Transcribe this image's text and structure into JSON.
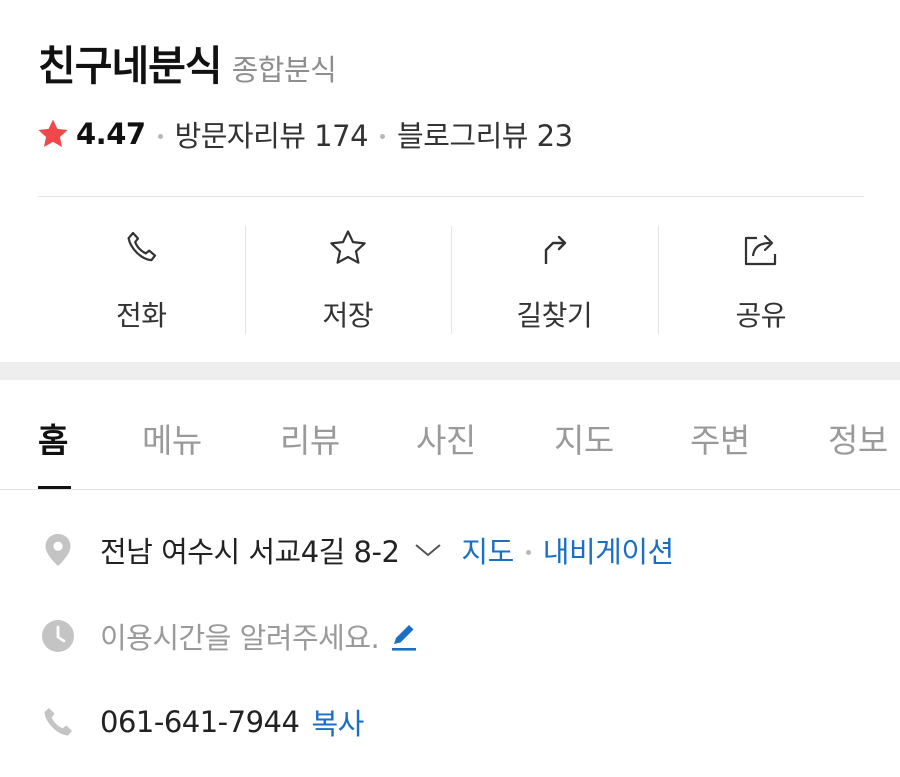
{
  "place": {
    "name": "친구네분식",
    "category": "종합분식",
    "rating": "4.47",
    "visitor_reviews": "방문자리뷰 174",
    "blog_reviews": "블로그리뷰 23"
  },
  "actions": {
    "call": "전화",
    "save": "저장",
    "directions": "길찾기",
    "share": "공유"
  },
  "tabs": {
    "home": "홈",
    "menu": "메뉴",
    "reviews": "리뷰",
    "photos": "사진",
    "map": "지도",
    "nearby": "주변",
    "info": "정보"
  },
  "details": {
    "address": "전남 여수시 서교4길 8-2",
    "map_link": "지도",
    "navigation_link": "내비게이션",
    "hours_prompt": "이용시간을 알려주세요.",
    "phone": "061-641-7944",
    "copy_link": "복사"
  },
  "colors": {
    "star": "#f04848",
    "link": "#1a6fc4",
    "muted": "#9a9a9a",
    "icon_gray": "#c4c4c4"
  }
}
